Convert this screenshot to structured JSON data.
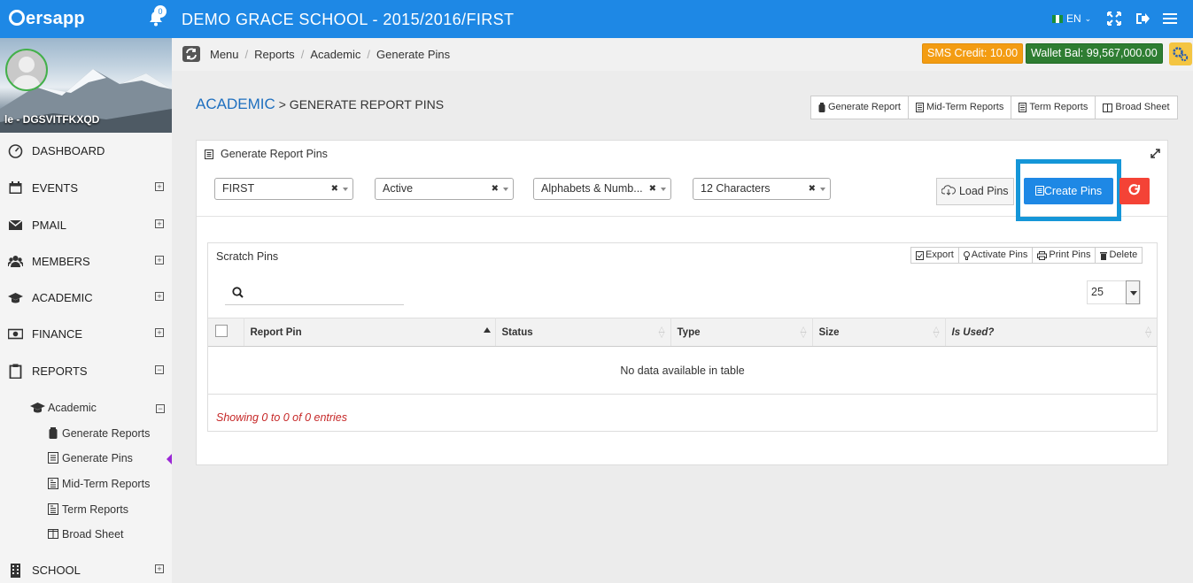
{
  "app": {
    "logo_text": "ersapp",
    "title": "DEMO GRACE SCHOOL - 2015/2016/FIRST",
    "notification_count": "0",
    "language": "EN"
  },
  "user": {
    "name": "le - DGSVITFKXQD"
  },
  "sidebar": {
    "items": [
      {
        "label": "DASHBOARD",
        "icon": "dashboard-icon",
        "expand": ""
      },
      {
        "label": "EVENTS",
        "icon": "calendar-icon",
        "expand": "+"
      },
      {
        "label": "PMAIL",
        "icon": "mail-icon",
        "expand": "+"
      },
      {
        "label": "MEMBERS",
        "icon": "users-icon",
        "expand": "+"
      },
      {
        "label": "ACADEMIC",
        "icon": "graduation-cap-icon",
        "expand": "+"
      },
      {
        "label": "FINANCE",
        "icon": "money-icon",
        "expand": "+"
      },
      {
        "label": "REPORTS",
        "icon": "clipboard-icon",
        "expand": "−"
      },
      {
        "label": "SCHOOL",
        "icon": "building-icon",
        "expand": "+"
      }
    ],
    "reports_submenu": {
      "label": "Academic",
      "expand": "−",
      "items": [
        {
          "label": "Generate Reports",
          "icon": "battery-icon"
        },
        {
          "label": "Generate Pins",
          "icon": "list-icon"
        },
        {
          "label": "Mid-Term Reports",
          "icon": "document-icon"
        },
        {
          "label": "Term Reports",
          "icon": "document-icon"
        },
        {
          "label": "Broad Sheet",
          "icon": "columns-icon"
        }
      ]
    }
  },
  "breadcrumb": [
    "Menu",
    "Reports",
    "Academic",
    "Generate Pins"
  ],
  "balances": {
    "sms_credit": "SMS Credit: 10.00",
    "wallet": "Wallet Bal: 99,567,000.00"
  },
  "page": {
    "heading_link": "ACADEMIC",
    "heading_rest": "> GENERATE REPORT PINS",
    "report_buttons": [
      "Generate Report",
      "Mid-Term Reports",
      "Term Reports",
      "Broad Sheet"
    ]
  },
  "panel": {
    "title": "Generate Report Pins",
    "filters": [
      {
        "value": "FIRST"
      },
      {
        "value": "Active"
      },
      {
        "value": "Alphabets & Numb..."
      },
      {
        "value": "12 Characters"
      }
    ],
    "load_pins": "Load Pins",
    "create_pins": "Create Pins"
  },
  "pins_table": {
    "title": "Scratch Pins",
    "tools": [
      "Export",
      "Activate Pins",
      "Print Pins",
      "Delete"
    ],
    "page_size": "25",
    "columns": [
      "Report Pin",
      "Status",
      "Type",
      "Size",
      "Is Used?"
    ],
    "empty_message": "No data available in table",
    "info": "Showing 0 to 0 of 0 entries"
  },
  "colors": {
    "topbar": "#1e88e5",
    "sms_badge": "#f39c12",
    "wallet_badge": "#2e7d32",
    "highlight": "#1596d8",
    "reset_button": "#f44336"
  }
}
